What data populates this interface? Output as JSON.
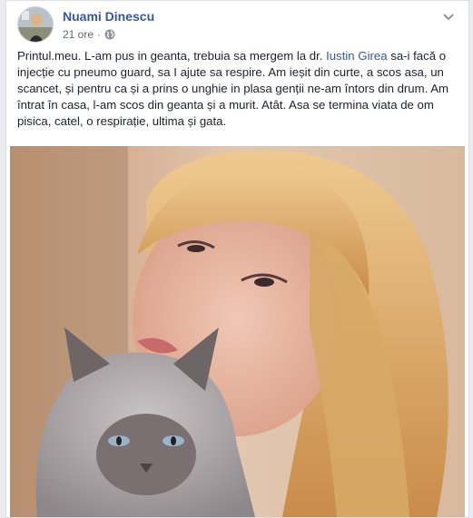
{
  "post": {
    "author": "Nuami Dinescu",
    "time": "21 ore",
    "dot": "·",
    "privacy_icon": "globe-icon",
    "more_icon": "chevron-down-icon",
    "text_before": "Printul.meu. L-am pus in geanta, trebuia sa mergem la dr. ",
    "mention": "Iustin Girea",
    "text_after": " sa-i facă o injecție cu pneumo guard, sa I ajute sa respire. Am ieșit din curte, a scos asa, un scancet, și pentru ca și a prins o unghie in plasa genții ne-am întors din drum. Am întrat în casa, l-am scos din geanta și a murit. Atât. Asa se termina viata de om pisica, catel, o respirație, ultima și gata."
  },
  "colors": {
    "link": "#365899",
    "text": "#1d2129",
    "meta": "#616770"
  }
}
